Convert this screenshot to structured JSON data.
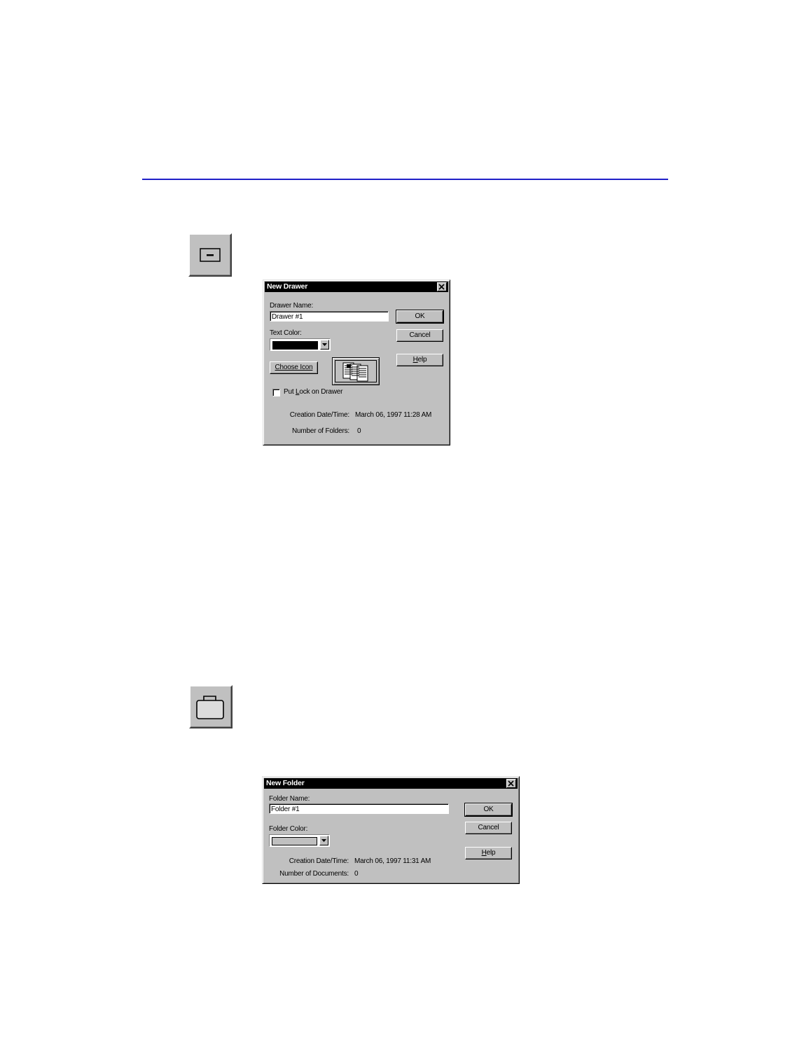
{
  "colors": {
    "rule": "#2020c8",
    "dialog_face": "#c0c0c0",
    "titlebar": "#000000"
  },
  "toolbar_icons": {
    "drawer": "drawer-icon",
    "folder": "folder-icon"
  },
  "new_drawer": {
    "title": "New Drawer",
    "name_label": "Drawer Name:",
    "name_value": "Drawer #1",
    "color_label": "Text Color:",
    "color_value": "#000000",
    "choose_icon_label": "Choose Icon",
    "lock_label_pre": "Put ",
    "lock_label_key": "L",
    "lock_label_post": "ock on Drawer",
    "lock_checked": false,
    "created_label": "Creation Date/Time:",
    "created_value": "March 06, 1997 11:28 AM",
    "count_label": "Number of Folders:",
    "count_value": "0",
    "ok": "OK",
    "cancel": "Cancel",
    "help_key": "H",
    "help_rest": "elp"
  },
  "new_folder": {
    "title": "New Folder",
    "name_label": "Folder Name:",
    "name_value": "Folder #1",
    "color_label": "Folder Color:",
    "color_value": "#c0c0c0",
    "created_label": "Creation Date/Time:",
    "created_value": "March 06, 1997 11:31 AM",
    "count_label": "Number of Documents:",
    "count_value": "0",
    "ok": "OK",
    "cancel": "Cancel",
    "help_key": "H",
    "help_rest": "elp"
  }
}
